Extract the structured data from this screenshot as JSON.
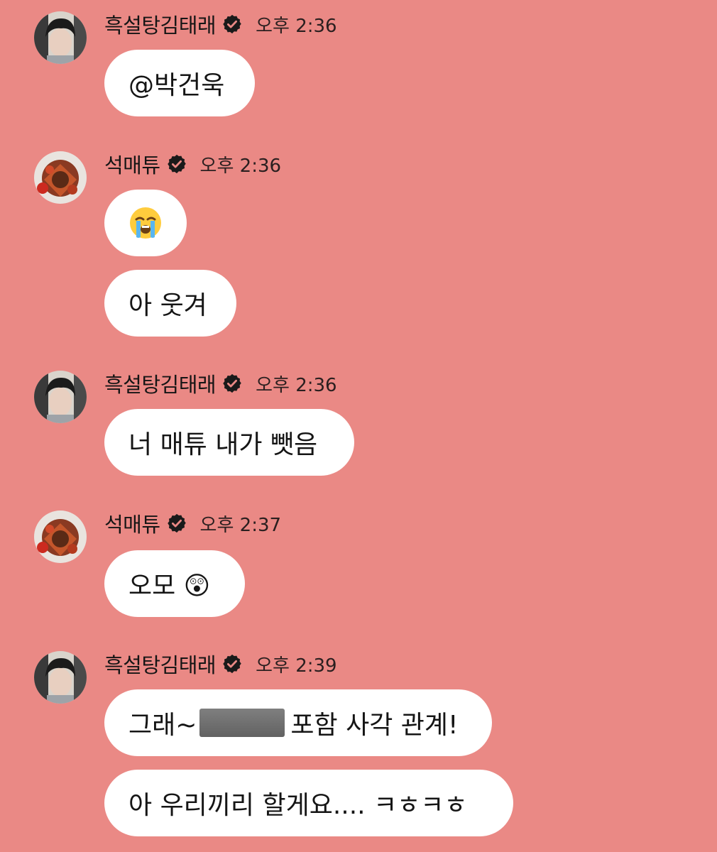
{
  "messages": [
    {
      "sender": "흑설탕김태래",
      "time": "오후 2:36",
      "bubbles": [
        "@박건욱"
      ]
    },
    {
      "sender": "석매튜",
      "time": "오후 2:36",
      "bubbles": [
        "😭",
        "아 웃겨"
      ]
    },
    {
      "sender": "흑설탕김태래",
      "time": "오후 2:36",
      "bubbles": [
        "너 매튜 내가 뺏음"
      ]
    },
    {
      "sender": "석매튜",
      "time": "오후 2:37",
      "bubbles": [
        "오모 😲"
      ]
    },
    {
      "sender": "흑설탕김태래",
      "time": "오후 2:39",
      "bubbles": [
        "그래~",
        "포함 사각 관계!",
        "아 우리끼리 할게요.... ㅋㅎㅋㅎ"
      ]
    }
  ],
  "icons": {
    "verified": "verified-badge-icon",
    "crying_emoji": "loudly-crying-face-emoji",
    "surprised_emoji": "hushed-face-emoji"
  },
  "colors": {
    "background": "#ea8985",
    "bubble": "#ffffff",
    "verified_badge": "#1a1a1a"
  }
}
